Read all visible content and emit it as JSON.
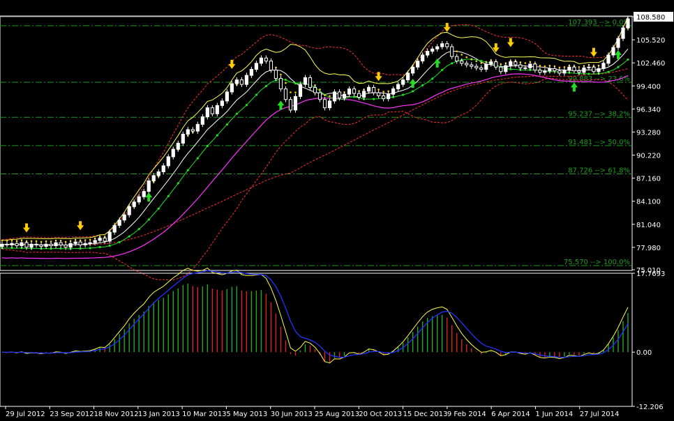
{
  "chart_data": [
    {
      "type": "candlestick",
      "ylim": [
        75.01,
        108.58
      ],
      "y_ticks": [
        "108.580",
        "105.520",
        "102.460",
        "99.400",
        "96.340",
        "93.280",
        "90.220",
        "87.160",
        "84.100",
        "81.040",
        "77.980",
        "75.010"
      ],
      "current_price": "108.580",
      "fib_levels": [
        {
          "value": 107.393,
          "label": "107.393 --> 0.0%"
        },
        {
          "value": 99.883,
          "label": "99.883 --> 23.6%"
        },
        {
          "value": 95.237,
          "label": "95.237 --> 38.2%"
        },
        {
          "value": 91.481,
          "label": "91.481 --> 50.0%"
        },
        {
          "value": 87.726,
          "label": "87.726 --> 61.8%"
        },
        {
          "value": 75.57,
          "label": "75.570 --> 100.0%"
        }
      ],
      "x_labels": [
        "29 Jul 2012",
        "23 Sep 2012",
        "18 Nov 2012",
        "13 Jan 2013",
        "10 Mar 2013",
        "5 May 2013",
        "30 Jun 2013",
        "25 Aug 2013",
        "20 Oct 2013",
        "15 Dec 2013",
        "9 Feb 2014",
        "6 Apr 2014",
        "1 Jun 2014",
        "27 Jul 2014"
      ],
      "series": [
        {
          "type": "candles",
          "close": [
            78.4,
            78.3,
            78.5,
            78.2,
            78.6,
            78.0,
            78.4,
            78.3,
            78.1,
            78.4,
            78.2,
            78.6,
            78.3,
            78.0,
            78.5,
            78.7,
            78.3,
            78.5,
            78.6,
            78.9,
            79.2,
            78.8,
            80.0,
            80.9,
            81.6,
            82.3,
            83.4,
            84.0,
            84.7,
            85.4,
            86.8,
            87.5,
            88.0,
            88.8,
            90.0,
            91.0,
            91.8,
            93.0,
            93.6,
            93.4,
            94.3,
            95.3,
            96.5,
            95.7,
            96.8,
            97.4,
            98.6,
            99.7,
            100.2,
            99.6,
            100.8,
            101.6,
            102.4,
            103.1,
            102.7,
            101.5,
            100.4,
            99.0,
            97.6,
            96.2,
            98.0,
            99.6,
            100.5,
            99.2,
            98.5,
            97.6,
            96.5,
            97.4,
            98.6,
            97.8,
            98.3,
            99.0,
            98.4,
            97.9,
            98.7,
            99.2,
            98.5,
            98.1,
            97.7,
            98.3,
            99.0,
            99.6,
            100.2,
            101.1,
            101.9,
            102.7,
            103.5,
            104.0,
            104.3,
            104.6,
            105.0,
            104.6,
            103.3,
            102.7,
            102.4,
            102.2,
            102.0,
            101.8,
            101.6,
            102.3,
            102.6,
            101.9,
            101.3,
            102.1,
            102.6,
            102.2,
            101.8,
            101.8,
            102.3,
            101.5,
            101.2,
            101.4,
            101.7,
            101.4,
            101.1,
            101.5,
            101.9,
            101.4,
            101.2,
            101.8,
            101.9,
            101.3,
            101.7,
            102.4,
            103.5,
            104.5,
            105.7,
            107.1,
            108.3
          ]
        },
        {
          "type": "line",
          "name": "",
          "color": "#ffff55"
        },
        {
          "type": "line",
          "name": "",
          "color": "#ffffff"
        },
        {
          "type": "line",
          "name": "",
          "color": "#22dd22"
        },
        {
          "type": "line",
          "name": "",
          "color": "#ff33ff"
        },
        {
          "type": "band",
          "name": "",
          "color": "#ff3030"
        }
      ],
      "fractal_up_index": [
        30,
        57,
        84,
        89,
        117,
        126,
        136
      ],
      "fractal_down_index": [
        5,
        16,
        47,
        77,
        91,
        101,
        104,
        121,
        132
      ]
    },
    {
      "type": "histogram",
      "ylim": [
        -12.206,
        17.7693
      ],
      "y_ticks": [
        "17.7693",
        "0.00",
        "-12.206"
      ],
      "series": [
        {
          "name": "",
          "type": "bar",
          "colors": {
            "up": "#22aa22",
            "down": "#dd2222"
          }
        },
        {
          "name": "",
          "type": "line",
          "color": "#ffff44"
        },
        {
          "name": "",
          "type": "line",
          "color": "#2233ff"
        }
      ]
    }
  ],
  "colors": {
    "background": "#000000",
    "grid_fib": "#1e9c1e",
    "frame": "#ffffff",
    "bull_candle": "#ffffff",
    "bear_candle": "#000000",
    "arrow_up": "#22dd22",
    "arrow_down": "#ffcc00"
  }
}
